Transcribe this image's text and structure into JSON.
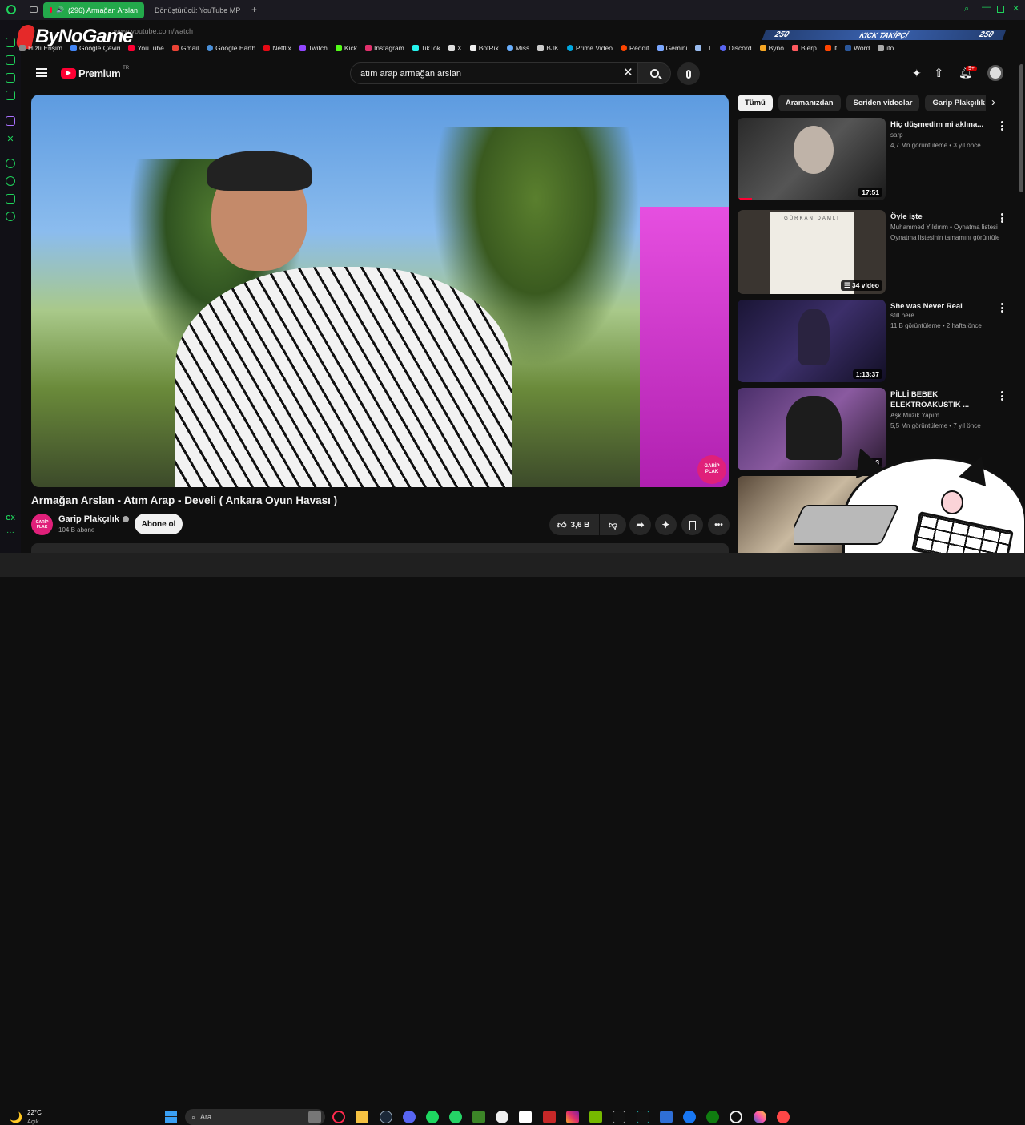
{
  "browser": {
    "tabs": [
      {
        "label": "(296) Armağan Arslan",
        "active": true
      },
      {
        "label": "Dönüştürücü: YouTube MP",
        "active": false
      }
    ],
    "url": "www.youtube.com/watch",
    "bookmarks": [
      "Hızlı Erişim",
      "Google Çeviri",
      "YouTube",
      "Gmail",
      "Google Earth",
      "Netflix",
      "Twitch",
      "Kick",
      "Instagram",
      "TikTok",
      "X",
      "BotRix",
      "Miss",
      "BJK",
      "Prime Video",
      "Reddit",
      "Gemini",
      "LT",
      "Discord",
      "Byno",
      "Blerp",
      "it",
      "Word",
      "ito"
    ],
    "sidebar_bottom_label": "GX"
  },
  "overlay": {
    "logo_text": "ByNoGame",
    "kick_counter_left": "250",
    "kick_counter_label": "KICK TAKİPÇİ",
    "kick_counter_right": "250"
  },
  "youtube": {
    "logo_text": "Premium",
    "logo_sup": "TR",
    "search_value": "atım arap armağan arslan",
    "notification_badge": "9+",
    "video": {
      "watermark": "GARİP PLAK",
      "title": "Armağan Arslan - Atım Arap - Develi ( Ankara Oyun Havası )",
      "channel": "Garip Plakçılık",
      "channel_avatar_text": "GARİP PLAK",
      "subscribers": "104 B abone",
      "subscribe_label": "Abone ol",
      "likes": "3,6 B"
    },
    "chips": [
      {
        "label": "Tümü",
        "selected": true
      },
      {
        "label": "Aramanızdan",
        "selected": false
      },
      {
        "label": "Seriden videolar",
        "selected": false
      },
      {
        "label": "Garip Plakçılık adlı y",
        "selected": false
      }
    ],
    "recommendations": [
      {
        "title": "Hiç düşmedim mi aklına...",
        "line1": "sarp",
        "line2": "4,7 Mn görüntüleme • 3 yıl önce",
        "duration": "17:51"
      },
      {
        "title": "Öyle işte",
        "line1": "Muhammed Yıldırım • Oynatma listesi",
        "line2": "Oynatma listesinin tamamını görüntüle",
        "duration": "34 video",
        "thumb_text": "GÜRKAN DAMLI"
      },
      {
        "title": "She was Never Real",
        "line1": "still here",
        "line2": "11 B görüntüleme • 2 hafta önce",
        "duration": "1:13:37"
      },
      {
        "title": "PİLLİ BEBEK ELEKTROAKUSTİK ...",
        "line1": "Aşk Müzik Yapım",
        "line2": "5,5 Mn görüntüleme • 7 yıl önce",
        "duration": "6:3"
      }
    ]
  },
  "taskbar": {
    "weather_temp": "22°C",
    "weather_desc": "Açık",
    "search_placeholder": "Ara"
  },
  "colors": {
    "accent_red": "#ff0033",
    "browser_green": "#23a94b",
    "bg": "#0f0f0f"
  }
}
